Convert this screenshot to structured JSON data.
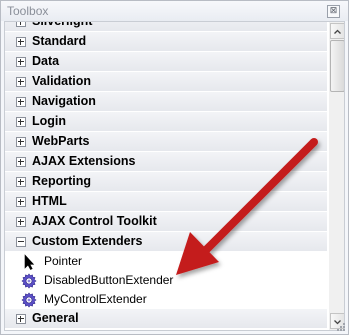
{
  "window": {
    "title": "Toolbox",
    "close_glyph": "⊠"
  },
  "categories_before": [
    {
      "label": "Silverlight"
    },
    {
      "label": "Standard"
    },
    {
      "label": "Data"
    },
    {
      "label": "Validation"
    },
    {
      "label": "Navigation"
    },
    {
      "label": "Login"
    },
    {
      "label": "WebParts"
    },
    {
      "label": "AJAX Extensions"
    },
    {
      "label": "Reporting"
    },
    {
      "label": "HTML"
    },
    {
      "label": "AJAX Control Toolkit"
    }
  ],
  "expanded_category": {
    "label": "Custom Extenders",
    "items": [
      {
        "label": "Pointer",
        "icon": "pointer-arrow-icon"
      },
      {
        "label": "DisabledButtonExtender",
        "icon": "gear-component-icon"
      },
      {
        "label": "MyControlExtender",
        "icon": "gear-component-icon"
      }
    ]
  },
  "categories_after": [
    {
      "label": "General"
    }
  ],
  "colors": {
    "annotation_arrow": "#c41c1c",
    "header_background": "#e8eaee",
    "icon_purple": "#5b4fc7"
  }
}
